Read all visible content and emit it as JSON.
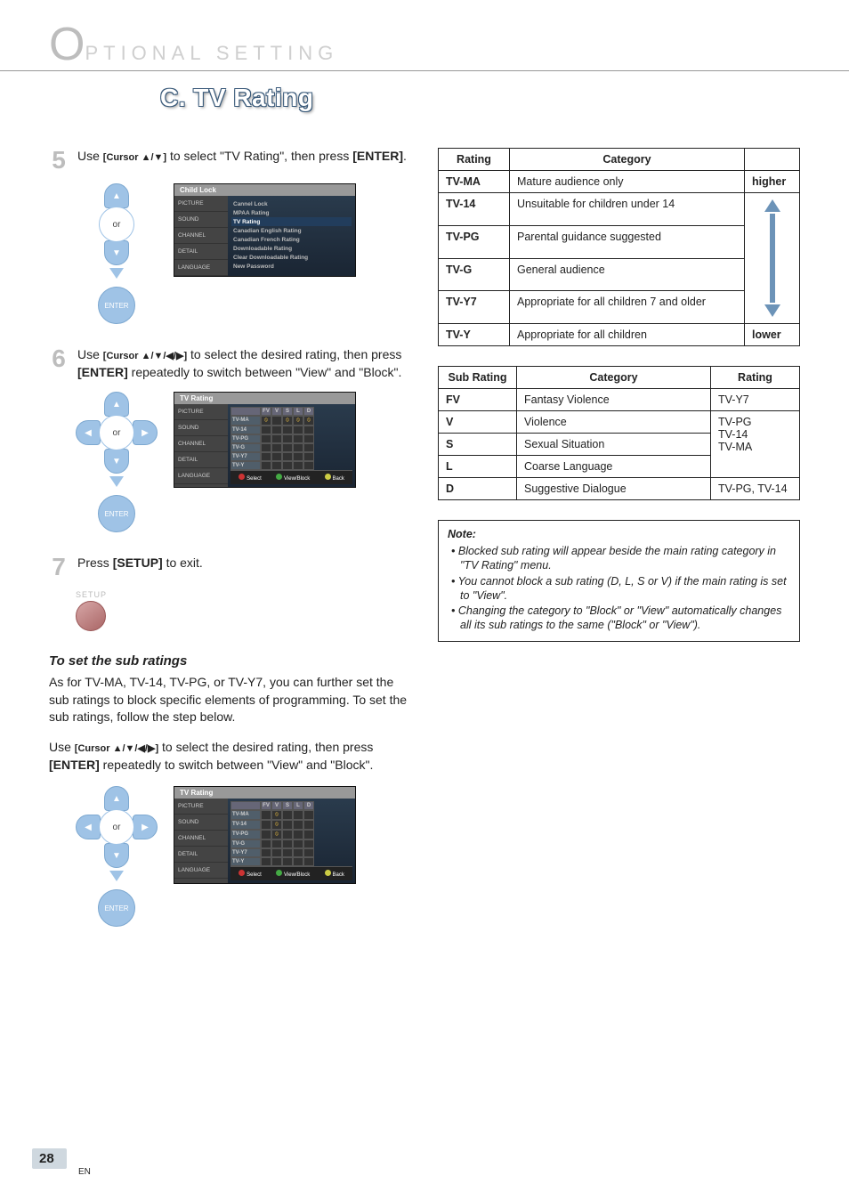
{
  "header": {
    "lead_char": "O",
    "rest": "PTIONAL  SETTING"
  },
  "section_title": "C. TV Rating",
  "steps": {
    "s5": {
      "num": "5",
      "pre": "Use ",
      "ctrl": "[Cursor ▲/▼]",
      "mid": " to select \"TV Rating\", then press ",
      "post": "[ENTER]",
      "tail": "."
    },
    "s6": {
      "num": "6",
      "pre": "Use ",
      "ctrl": "[Cursor ▲/▼/◀/▶]",
      "mid": " to select the desired rating, then press ",
      "post": "[ENTER]",
      "tail": " repeatedly to switch between \"View\" and \"Block\"."
    },
    "s7": {
      "num": "7",
      "pre": "Press ",
      "ctrl": "[SETUP]",
      "tail": " to exit."
    }
  },
  "remote": {
    "or": "or",
    "enter": "ENTER",
    "setup": "SETUP"
  },
  "osd1": {
    "title": "Child Lock",
    "tabs": [
      "PICTURE",
      "SOUND",
      "CHANNEL",
      "DETAIL",
      "LANGUAGE"
    ],
    "items": [
      "Cannel Lock",
      "MPAA Rating",
      "TV Rating",
      "Canadian English Rating",
      "Canadian French Rating",
      "Downloadable Rating",
      "Clear Downloadable Rating",
      "New Password"
    ],
    "hl_index": 2
  },
  "osd2": {
    "title": "TV Rating",
    "cols": [
      "",
      "FV",
      "V",
      "S",
      "L",
      "D"
    ],
    "rows": [
      {
        "label": "TV-MA",
        "cells": [
          "⦸",
          "",
          "⦸",
          "⦸",
          "⦸"
        ]
      },
      {
        "label": "TV-14",
        "cells": [
          "",
          "",
          "",
          "",
          ""
        ]
      },
      {
        "label": "TV-PG",
        "cells": [
          "",
          "",
          "",
          "",
          ""
        ]
      },
      {
        "label": "TV-G",
        "cells": [
          "",
          "",
          "",
          "",
          ""
        ]
      },
      {
        "label": "TV-Y7",
        "cells": [
          "",
          "",
          "",
          "",
          ""
        ]
      },
      {
        "label": "TV-Y",
        "cells": [
          "",
          "",
          "",
          "",
          ""
        ]
      }
    ],
    "foot": [
      "Select",
      "View/Block",
      "Back"
    ]
  },
  "sub_section": {
    "heading": "To set the sub ratings",
    "para1": "As for TV-MA, TV-14, TV-PG, or TV-Y7, you can further set the sub ratings to block specific elements of programming. To set the sub ratings, follow the step below.",
    "para2_pre": "Use ",
    "para2_ctrl": "[Cursor ▲/▼/◀/▶]",
    "para2_mid": " to select the desired rating, then press ",
    "para2_post": "[ENTER]",
    "para2_tail": " repeatedly to switch between \"View\" and \"Block\"."
  },
  "osd3": {
    "title": "TV Rating",
    "cols": [
      "",
      "FV",
      "V",
      "S",
      "L",
      "D"
    ],
    "rows": [
      {
        "label": "TV-MA",
        "cells": [
          "",
          "⦸",
          "",
          "",
          ""
        ]
      },
      {
        "label": "TV-14",
        "cells": [
          "",
          "⦸",
          "",
          "",
          ""
        ]
      },
      {
        "label": "TV-PG",
        "cells": [
          "",
          "⦸",
          "",
          "",
          ""
        ]
      },
      {
        "label": "TV-G",
        "cells": [
          "",
          "",
          "",
          "",
          ""
        ]
      },
      {
        "label": "TV-Y7",
        "cells": [
          "",
          "",
          "",
          "",
          ""
        ]
      },
      {
        "label": "TV-Y",
        "cells": [
          "",
          "",
          "",
          "",
          ""
        ]
      }
    ],
    "foot": [
      "Select",
      "View/Block",
      "Back"
    ]
  },
  "table1": {
    "headers": [
      "Rating",
      "Category",
      ""
    ],
    "dir_high": "higher",
    "dir_low": "lower",
    "rows": [
      {
        "r": "TV-MA",
        "c": "Mature audience only"
      },
      {
        "r": "TV-14",
        "c": "Unsuitable for children under 14"
      },
      {
        "r": "TV-PG",
        "c": "Parental guidance suggested"
      },
      {
        "r": "TV-G",
        "c": "General audience"
      },
      {
        "r": "TV-Y7",
        "c": "Appropriate for all children 7 and older"
      },
      {
        "r": "TV-Y",
        "c": "Appropriate for all children"
      }
    ]
  },
  "table2": {
    "headers": [
      "Sub Rating",
      "Category",
      "Rating"
    ],
    "rows": [
      {
        "r": "FV",
        "c": "Fantasy Violence",
        "notes": "TV-Y7"
      },
      {
        "r": "V",
        "c": "Violence",
        "notes": ""
      },
      {
        "r": "S",
        "c": "Sexual Situation",
        "notes": ""
      },
      {
        "r": "L",
        "c": "Coarse Language",
        "notes": ""
      },
      {
        "r": "D",
        "c": "Suggestive Dialogue",
        "notes": "TV-PG, TV-14"
      }
    ],
    "merged_notes": "TV-PG\nTV-14\nTV-MA"
  },
  "note": {
    "title": "Note:",
    "items": [
      "Blocked sub rating will appear beside the main rating category in \"TV Rating\" menu.",
      "You cannot block a sub rating (D, L, S or V) if the main rating is set to \"View\".",
      "Changing the category to \"Block\" or \"View\" automatically changes all its sub ratings to the same (\"Block\" or \"View\")."
    ]
  },
  "footer": {
    "page": "28",
    "lang": "EN"
  },
  "osd_foot_back_label": "BACK"
}
